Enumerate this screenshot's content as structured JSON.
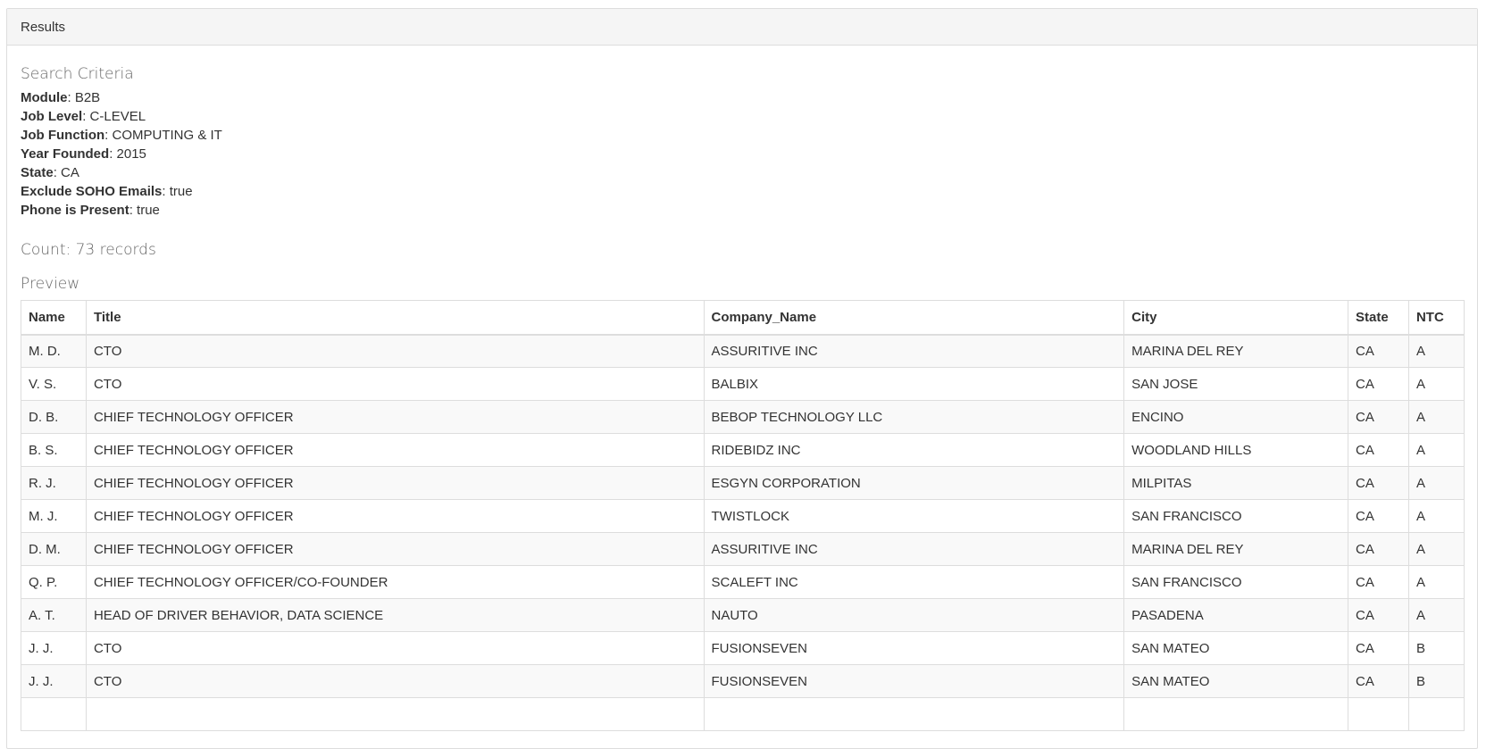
{
  "panel": {
    "heading": "Results"
  },
  "search_criteria": {
    "title": "Search Criteria",
    "items": [
      {
        "label": "Module",
        "value": ": B2B"
      },
      {
        "label": "Job Level",
        "value": ": C-LEVEL"
      },
      {
        "label": "Job Function",
        "value": ": COMPUTING & IT"
      },
      {
        "label": "Year Founded",
        "value": ": 2015"
      },
      {
        "label": "State",
        "value": ": CA"
      },
      {
        "label": "Exclude SOHO Emails",
        "value": ": true"
      },
      {
        "label": "Phone is Present",
        "value": ": true"
      }
    ]
  },
  "count": {
    "text": "Count: 73 records"
  },
  "preview": {
    "title": "Preview",
    "columns": [
      "Name",
      "Title",
      "Company_Name",
      "City",
      "State",
      "NTC"
    ],
    "rows": [
      [
        "M. D.",
        "CTO",
        "ASSURITIVE INC",
        "MARINA DEL REY",
        "CA",
        "A"
      ],
      [
        "V. S.",
        "CTO",
        "BALBIX",
        "SAN JOSE",
        "CA",
        "A"
      ],
      [
        "D. B.",
        "CHIEF TECHNOLOGY OFFICER",
        "BEBOP TECHNOLOGY LLC",
        "ENCINO",
        "CA",
        "A"
      ],
      [
        "B. S.",
        "CHIEF TECHNOLOGY OFFICER",
        "RIDEBIDZ INC",
        "WOODLAND HILLS",
        "CA",
        "A"
      ],
      [
        "R. J.",
        "CHIEF TECHNOLOGY OFFICER",
        "ESGYN CORPORATION",
        "MILPITAS",
        "CA",
        "A"
      ],
      [
        "M. J.",
        "CHIEF TECHNOLOGY OFFICER",
        "TWISTLOCK",
        "SAN FRANCISCO",
        "CA",
        "A"
      ],
      [
        "D. M.",
        "CHIEF TECHNOLOGY OFFICER",
        "ASSURITIVE INC",
        "MARINA DEL REY",
        "CA",
        "A"
      ],
      [
        "Q. P.",
        "CHIEF TECHNOLOGY OFFICER/CO-FOUNDER",
        "SCALEFT INC",
        "SAN FRANCISCO",
        "CA",
        "A"
      ],
      [
        "A. T.",
        "HEAD OF DRIVER BEHAVIOR, DATA SCIENCE",
        "NAUTO",
        "PASADENA",
        "CA",
        "A"
      ],
      [
        "J. J.",
        "CTO",
        "FUSIONSEVEN",
        "SAN MATEO",
        "CA",
        "B"
      ],
      [
        "J. J.",
        "CTO",
        "FUSIONSEVEN",
        "SAN MATEO",
        "CA",
        "B"
      ],
      [
        "",
        "",
        "",
        "",
        "",
        ""
      ]
    ]
  }
}
